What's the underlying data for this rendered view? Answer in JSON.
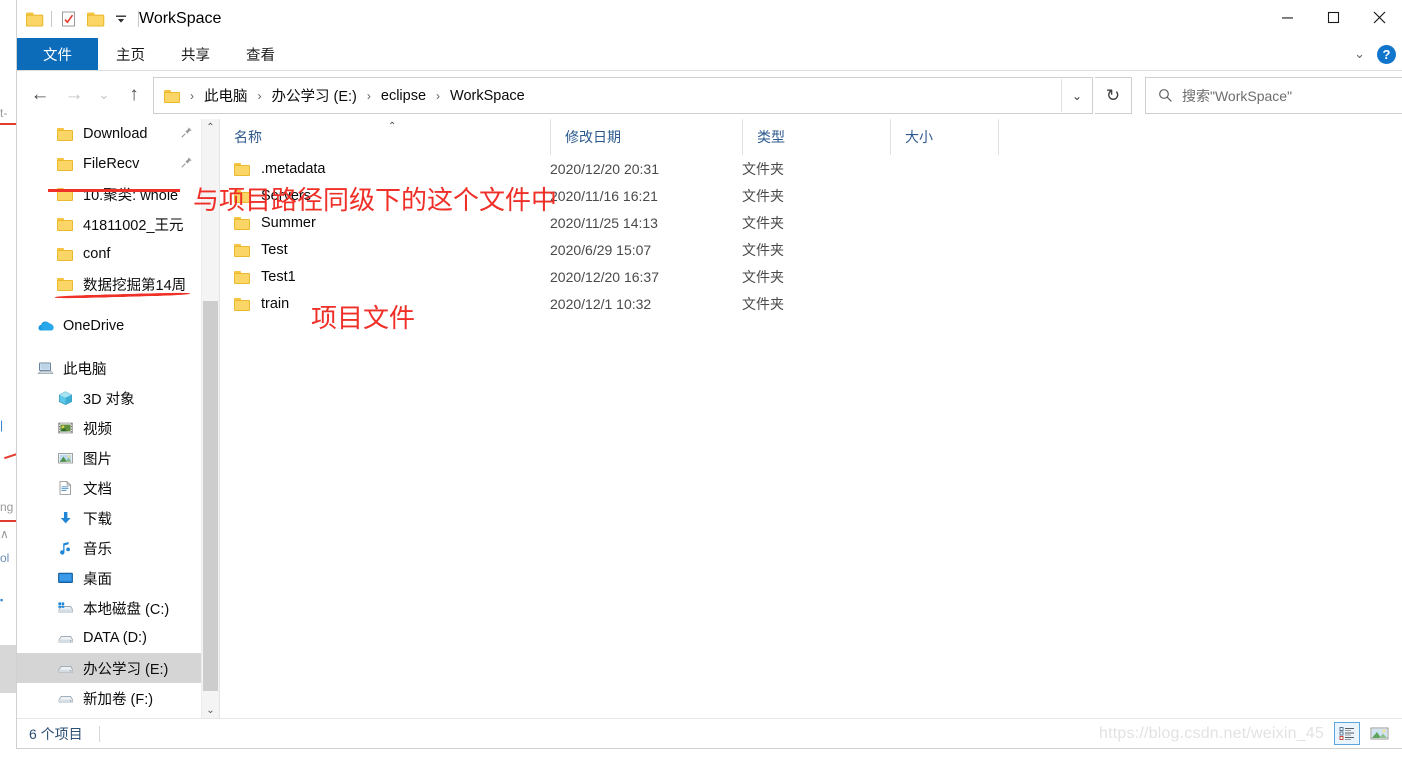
{
  "window": {
    "title": "WorkSpace",
    "quick_access": [
      {
        "name": "folder-icon",
        "label": ""
      },
      {
        "name": "properties-icon",
        "label": ""
      },
      {
        "name": "new-folder-icon",
        "label": ""
      },
      {
        "name": "customize-dropdown-icon",
        "label": "▾"
      }
    ],
    "controls": {
      "minimize": "—",
      "maximize": "□",
      "close": "✕"
    }
  },
  "ribbon": {
    "tabs": [
      {
        "label": "文件",
        "active": true
      },
      {
        "label": "主页",
        "active": false
      },
      {
        "label": "共享",
        "active": false
      },
      {
        "label": "查看",
        "active": false
      }
    ],
    "collapse_icon": "⌄",
    "help_label": "?"
  },
  "address": {
    "back_icon": "←",
    "forward_icon": "→",
    "recent_icon": "⌄",
    "up_icon": "↑",
    "breadcrumbs": [
      "此电脑",
      "办公学习 (E:)",
      "eclipse",
      "WorkSpace"
    ],
    "separator": "›",
    "dropdown_icon": "⌄",
    "refresh_icon": "↻"
  },
  "search": {
    "icon": "search-icon",
    "placeholder": "搜索\"WorkSpace\""
  },
  "nav_pane": {
    "items": [
      {
        "label": "Download",
        "icon": "folder",
        "indent": "lvl2",
        "pinned": true,
        "selected": false
      },
      {
        "label": "FileRecv",
        "icon": "folder",
        "indent": "lvl2",
        "pinned": true,
        "selected": false
      },
      {
        "label": "10.聚类: whole",
        "icon": "folder",
        "indent": "lvl2",
        "pinned": false,
        "selected": false
      },
      {
        "label": "41811002_王元",
        "icon": "folder",
        "indent": "lvl2",
        "pinned": false,
        "selected": false
      },
      {
        "label": "conf",
        "icon": "folder",
        "indent": "lvl2",
        "pinned": false,
        "selected": false
      },
      {
        "label": "数据挖掘第14周",
        "icon": "folder",
        "indent": "lvl2",
        "pinned": false,
        "selected": false
      },
      {
        "label": "OneDrive",
        "icon": "onedrive",
        "indent": "root",
        "pinned": false,
        "selected": false
      },
      {
        "label": "此电脑",
        "icon": "pc",
        "indent": "root",
        "pinned": false,
        "selected": false
      },
      {
        "label": "3D 对象",
        "icon": "3d",
        "indent": "lvl2",
        "pinned": false,
        "selected": false
      },
      {
        "label": "视频",
        "icon": "video",
        "indent": "lvl2",
        "pinned": false,
        "selected": false
      },
      {
        "label": "图片",
        "icon": "picture",
        "indent": "lvl2",
        "pinned": false,
        "selected": false
      },
      {
        "label": "文档",
        "icon": "document",
        "indent": "lvl2",
        "pinned": false,
        "selected": false
      },
      {
        "label": "下载",
        "icon": "download",
        "indent": "lvl2",
        "pinned": false,
        "selected": false
      },
      {
        "label": "音乐",
        "icon": "music",
        "indent": "lvl2",
        "pinned": false,
        "selected": false
      },
      {
        "label": "桌面",
        "icon": "desktop",
        "indent": "lvl2",
        "pinned": false,
        "selected": false
      },
      {
        "label": "本地磁盘 (C:)",
        "icon": "systemdrive",
        "indent": "lvl2",
        "pinned": false,
        "selected": false
      },
      {
        "label": "DATA (D:)",
        "icon": "drive",
        "indent": "lvl2",
        "pinned": false,
        "selected": false
      },
      {
        "label": "办公学习 (E:)",
        "icon": "drive",
        "indent": "lvl2",
        "pinned": false,
        "selected": true
      },
      {
        "label": "新加卷 (F:)",
        "icon": "drive",
        "indent": "lvl2",
        "pinned": false,
        "selected": false
      }
    ],
    "pin_glyph": "📌",
    "scroll_up_icon": "⌃",
    "scroll_down_icon": "⌄"
  },
  "file_list": {
    "columns": [
      {
        "label": "名称",
        "sorted": true,
        "sort_dir": "asc"
      },
      {
        "label": "修改日期",
        "sorted": false
      },
      {
        "label": "类型",
        "sorted": false
      },
      {
        "label": "大小",
        "sorted": false
      }
    ],
    "rows": [
      {
        "name": ".metadata",
        "date": "2020/12/20 20:31",
        "type": "文件夹",
        "size": ""
      },
      {
        "name": "Servers",
        "date": "2020/11/16 16:21",
        "type": "文件夹",
        "size": ""
      },
      {
        "name": "Summer",
        "date": "2020/11/25 14:13",
        "type": "文件夹",
        "size": ""
      },
      {
        "name": "Test",
        "date": "2020/6/29 15:07",
        "type": "文件夹",
        "size": ""
      },
      {
        "name": "Test1",
        "date": "2020/12/20 16:37",
        "type": "文件夹",
        "size": ""
      },
      {
        "name": "train",
        "date": "2020/12/1 10:32",
        "type": "文件夹",
        "size": ""
      }
    ]
  },
  "annotations": {
    "color": "#ef2f28",
    "items": [
      {
        "text": "与项目路径同级下的这个文件中"
      },
      {
        "text": "项目文件"
      }
    ]
  },
  "status_bar": {
    "item_count": "6 个项目",
    "views": [
      {
        "name": "details-view-button",
        "active": true
      },
      {
        "name": "large-icons-view-button",
        "active": false
      }
    ]
  },
  "watermark": "https://blog.csdn.net/weixin_45",
  "background_window": {
    "lines": [
      "t-",
      "ng",
      "∧",
      "ol"
    ]
  }
}
